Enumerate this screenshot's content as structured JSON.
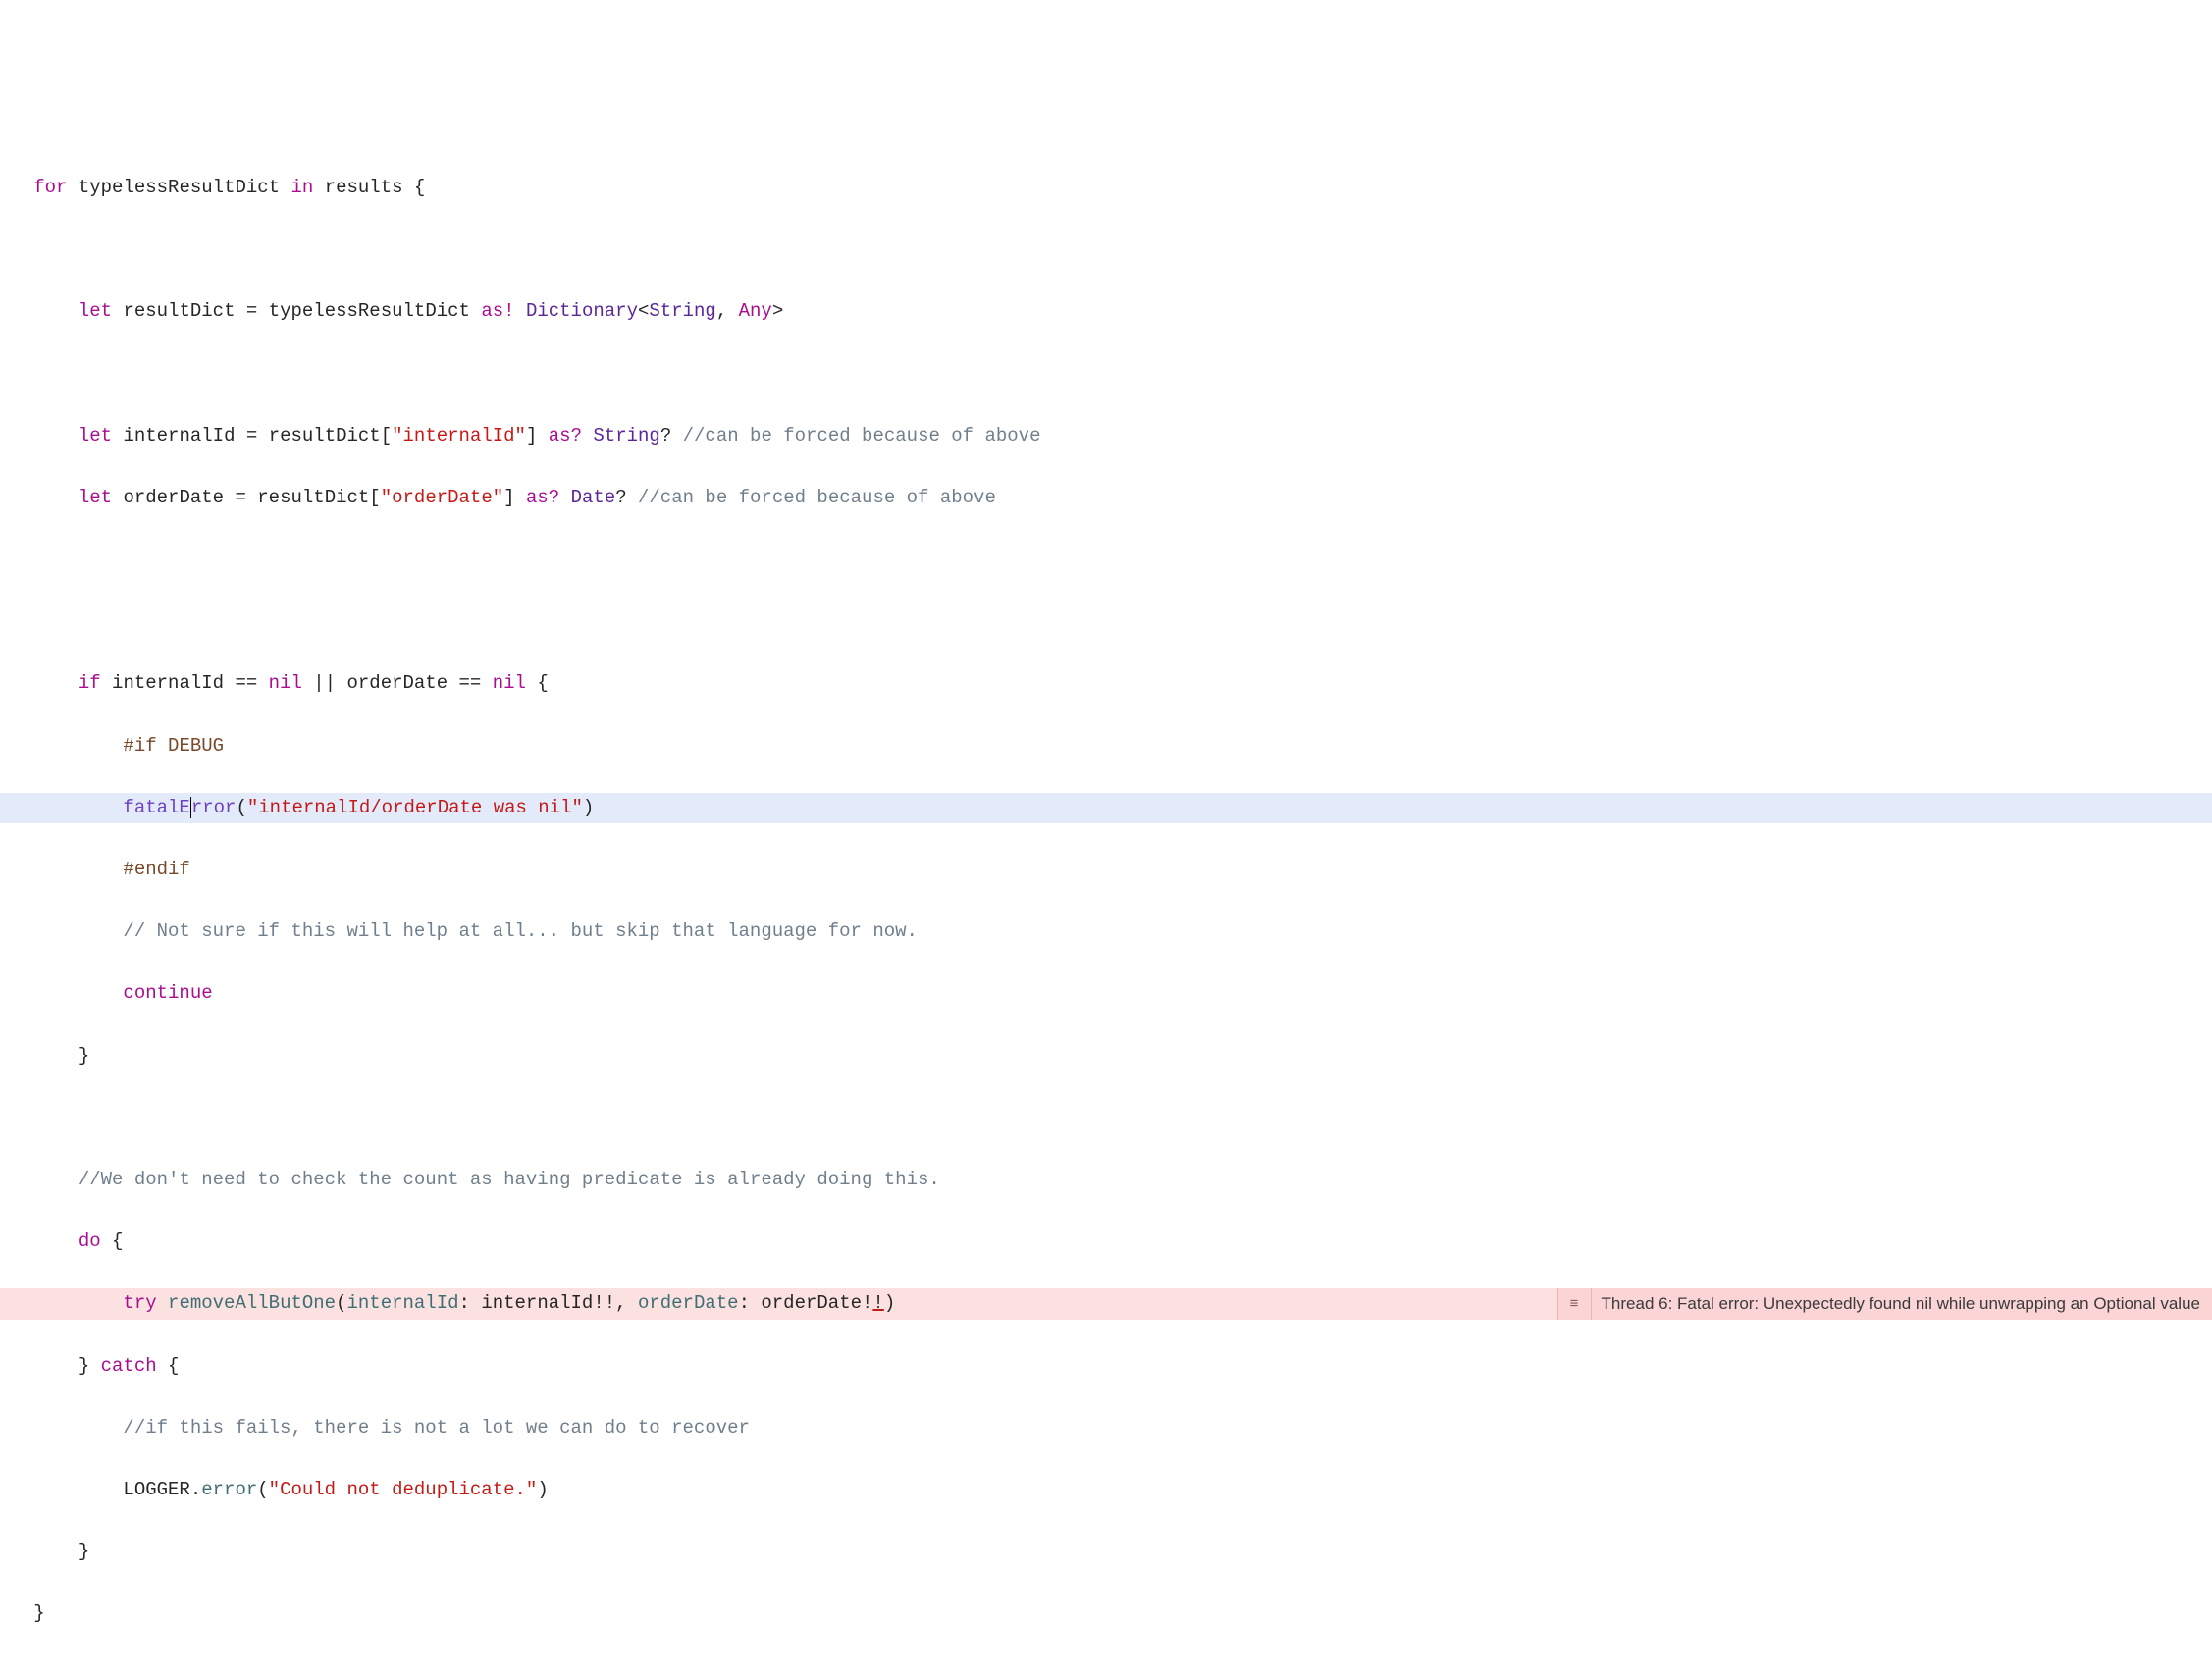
{
  "code": {
    "l1": {
      "for": "for",
      "var1": "typelessResultDict",
      "in": "in",
      "iter": "results {"
    },
    "l2": {
      "let": "let",
      "name": "resultDict",
      "eq": " = typelessResultDict ",
      "as": "as!",
      "sp": " ",
      "type": "Dictionary",
      "lt": "<",
      "t1": "String",
      "comma": ", ",
      "t2": "Any",
      "gt": ">"
    },
    "l3": {
      "let": "let",
      "name": "internalId",
      "eq": " = resultDict[",
      "str": "\"internalId\"",
      "close": "] ",
      "as": "as?",
      "sp": " ",
      "type": "String",
      "q": "? ",
      "comment": "//can be forced because of above"
    },
    "l4": {
      "let": "let",
      "name": "orderDate",
      "eq": " = resultDict[",
      "str": "\"orderDate\"",
      "close": "] ",
      "as": "as?",
      "sp": " ",
      "type": "Date",
      "q": "? ",
      "comment": "//can be forced because of above"
    },
    "l5": {
      "if": "if",
      "c1": " internalId == ",
      "nil1": "nil",
      "or": " || orderDate == ",
      "nil2": "nil",
      "brace": " {"
    },
    "l6": {
      "pp": "#if",
      "debug": " DEBUG"
    },
    "l7": {
      "fn": "fatalE",
      "fn2": "rror",
      "open": "(",
      "str": "\"internalId/orderDate was nil\"",
      "close": ")"
    },
    "l8": {
      "pp": "#endif"
    },
    "l9": {
      "comment": "// Not sure if this will help at all... but skip that language for now."
    },
    "l10": {
      "kw": "continue"
    },
    "l11": {
      "brace": "}"
    },
    "l12": {
      "comment": "//We don't need to check the count as having predicate is already doing this."
    },
    "l13": {
      "do": "do",
      "brace": " {"
    },
    "l14": {
      "try": "try",
      "sp": " ",
      "fn": "removeAllButOne",
      "open": "(",
      "p1": "internalId",
      "a1": ": internalId!!, ",
      "p2": "orderDate",
      "a2": ": orderDate!",
      "bang": "!",
      "close": ")"
    },
    "l15": {
      "brace": "} ",
      "catch": "catch",
      "brace2": " {"
    },
    "l16": {
      "comment": "//if this fails, there is not a lot we can do to recover"
    },
    "l17": {
      "logger": "LOGGER",
      "dot": ".",
      "fn": "error",
      "open": "(",
      "str": "\"Could not deduplicate.\"",
      "close": ")"
    },
    "l18": {
      "brace": "}"
    },
    "l19": {
      "brace": "}"
    }
  },
  "error": {
    "icon": "≡",
    "text": "Thread 6: Fatal error: Unexpectedly found nil while unwrapping an Optional value"
  }
}
